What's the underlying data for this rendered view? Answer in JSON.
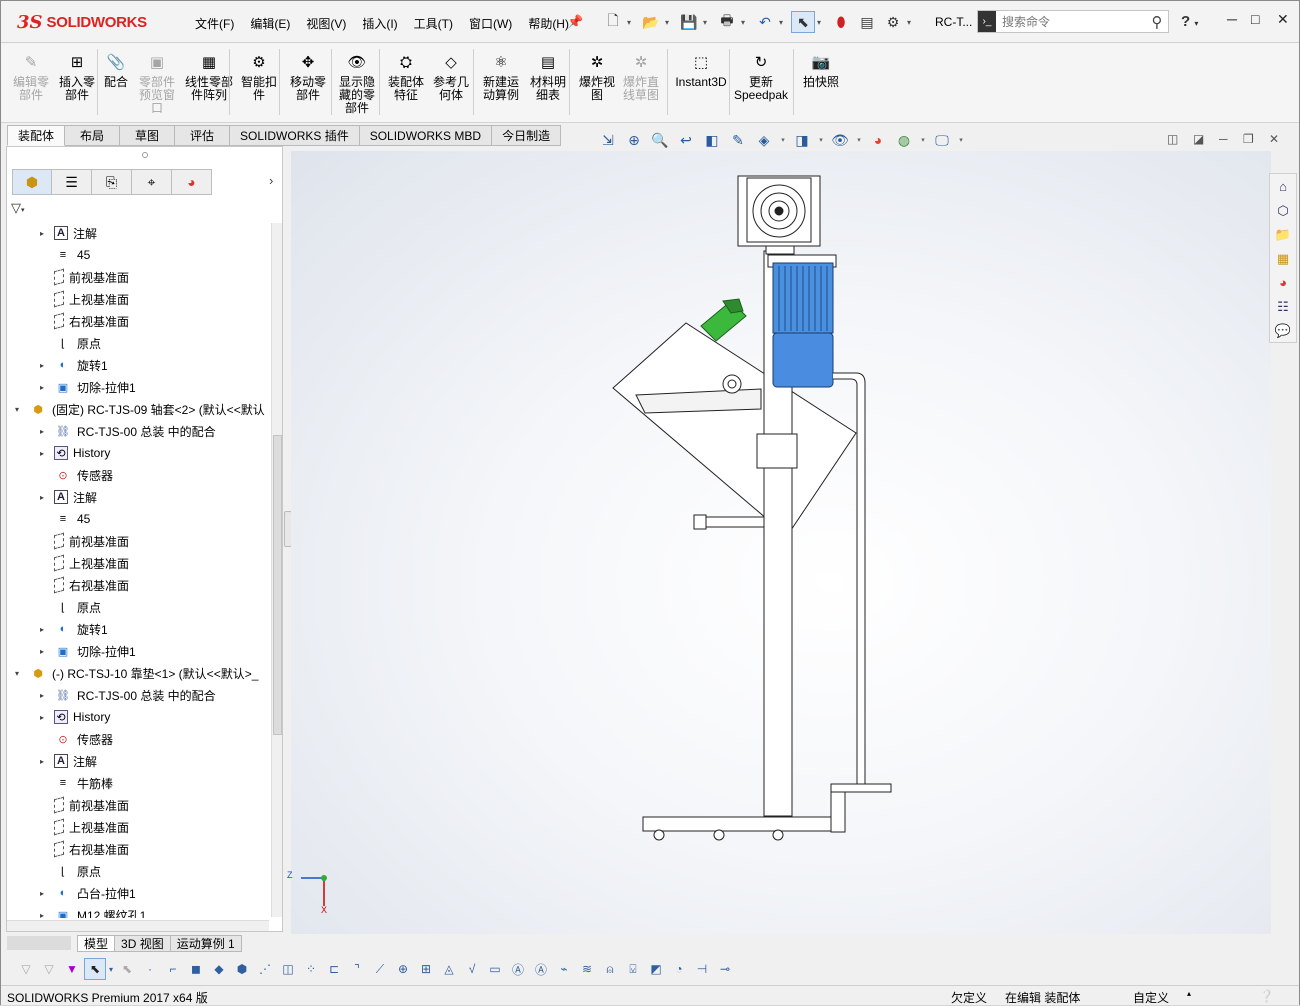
{
  "app": {
    "logo_ds": "3S",
    "logo_text": "SOLIDWORKS",
    "doc_name": "RC-T..."
  },
  "menus": [
    "文件(F)",
    "编辑(E)",
    "视图(V)",
    "插入(I)",
    "工具(T)",
    "窗口(W)",
    "帮助(H)"
  ],
  "search": {
    "placeholder": "搜索命令"
  },
  "window_controls": [
    "─",
    "□",
    "✕"
  ],
  "commands": [
    {
      "label": "编辑零\n部件",
      "disabled": true
    },
    {
      "label": "插入零\n部件",
      "disabled": false
    },
    {
      "label": "配合",
      "disabled": false
    },
    {
      "label": "零部件\n预览窗\n口",
      "disabled": true
    },
    {
      "label": "线性零部\n件阵列",
      "disabled": false
    },
    {
      "label": "智能扣\n件",
      "disabled": false
    },
    {
      "label": "移动零\n部件",
      "disabled": false
    },
    {
      "label": "显示隐\n藏的零\n部件",
      "disabled": false
    },
    {
      "label": "装配体\n特征",
      "disabled": false
    },
    {
      "label": "参考几\n何体",
      "disabled": false
    },
    {
      "label": "新建运\n动算例",
      "disabled": false
    },
    {
      "label": "材料明\n细表",
      "disabled": false
    },
    {
      "label": "爆炸视\n图",
      "disabled": false
    },
    {
      "label": "爆炸直\n线草图",
      "disabled": true
    },
    {
      "label": "Instant3D",
      "disabled": false
    },
    {
      "label": "更新\nSpeedpak",
      "disabled": false
    },
    {
      "label": "拍快照",
      "disabled": false
    }
  ],
  "tabs": [
    "装配体",
    "布局",
    "草图",
    "评估",
    "SOLIDWORKS 插件",
    "SOLIDWORKS MBD",
    "今日制造"
  ],
  "active_tab": "装配体",
  "tree": [
    {
      "indent": 1,
      "exp": "▸",
      "icon": "note",
      "label": "注解"
    },
    {
      "indent": 1,
      "exp": "",
      "icon": "eq",
      "label": "45"
    },
    {
      "indent": 1,
      "exp": "",
      "icon": "plane",
      "label": "前视基准面"
    },
    {
      "indent": 1,
      "exp": "",
      "icon": "plane",
      "label": "上视基准面"
    },
    {
      "indent": 1,
      "exp": "",
      "icon": "plane",
      "label": "右视基准面"
    },
    {
      "indent": 1,
      "exp": "",
      "icon": "orig",
      "label": "原点"
    },
    {
      "indent": 1,
      "exp": "▸",
      "icon": "feat",
      "label": "旋转1"
    },
    {
      "indent": 1,
      "exp": "▸",
      "icon": "cut",
      "label": "切除-拉伸1"
    },
    {
      "indent": 0,
      "exp": "▾",
      "icon": "asm",
      "label": "(固定) RC-TJS-09 轴套<2> (默认<<默认"
    },
    {
      "indent": 1,
      "exp": "▸",
      "icon": "mate",
      "label": "RC-TJS-00 总装 中的配合"
    },
    {
      "indent": 1,
      "exp": "▸",
      "icon": "hist",
      "label": "History"
    },
    {
      "indent": 1,
      "exp": "",
      "icon": "sens",
      "label": "传感器"
    },
    {
      "indent": 1,
      "exp": "▸",
      "icon": "note",
      "label": "注解"
    },
    {
      "indent": 1,
      "exp": "",
      "icon": "eq",
      "label": "45"
    },
    {
      "indent": 1,
      "exp": "",
      "icon": "plane",
      "label": "前视基准面"
    },
    {
      "indent": 1,
      "exp": "",
      "icon": "plane",
      "label": "上视基准面"
    },
    {
      "indent": 1,
      "exp": "",
      "icon": "plane",
      "label": "右视基准面"
    },
    {
      "indent": 1,
      "exp": "",
      "icon": "orig",
      "label": "原点"
    },
    {
      "indent": 1,
      "exp": "▸",
      "icon": "feat",
      "label": "旋转1"
    },
    {
      "indent": 1,
      "exp": "▸",
      "icon": "cut",
      "label": "切除-拉伸1"
    },
    {
      "indent": 0,
      "exp": "▾",
      "icon": "asm",
      "label": "(-) RC-TSJ-10 靠垫<1> (默认<<默认>_"
    },
    {
      "indent": 1,
      "exp": "▸",
      "icon": "mate",
      "label": "RC-TJS-00 总装 中的配合"
    },
    {
      "indent": 1,
      "exp": "▸",
      "icon": "hist",
      "label": "History"
    },
    {
      "indent": 1,
      "exp": "",
      "icon": "sens",
      "label": "传感器"
    },
    {
      "indent": 1,
      "exp": "▸",
      "icon": "note",
      "label": "注解"
    },
    {
      "indent": 1,
      "exp": "",
      "icon": "eq",
      "label": "牛筋棒"
    },
    {
      "indent": 1,
      "exp": "",
      "icon": "plane",
      "label": "前视基准面"
    },
    {
      "indent": 1,
      "exp": "",
      "icon": "plane",
      "label": "上视基准面"
    },
    {
      "indent": 1,
      "exp": "",
      "icon": "plane",
      "label": "右视基准面"
    },
    {
      "indent": 1,
      "exp": "",
      "icon": "orig",
      "label": "原点"
    },
    {
      "indent": 1,
      "exp": "▸",
      "icon": "feat",
      "label": "凸台-拉伸1"
    },
    {
      "indent": 1,
      "exp": "▸",
      "icon": "cut",
      "label": "M12 螺纹孔1"
    }
  ],
  "bottom_tabs": [
    "模型",
    "3D 视图",
    "运动算例 1"
  ],
  "triad": {
    "z": "Z",
    "x": "X"
  },
  "status": {
    "product": "SOLIDWORKS Premium 2017 x64 版",
    "def": "欠定义",
    "editing": "在编辑 装配体",
    "custom": "自定义"
  }
}
